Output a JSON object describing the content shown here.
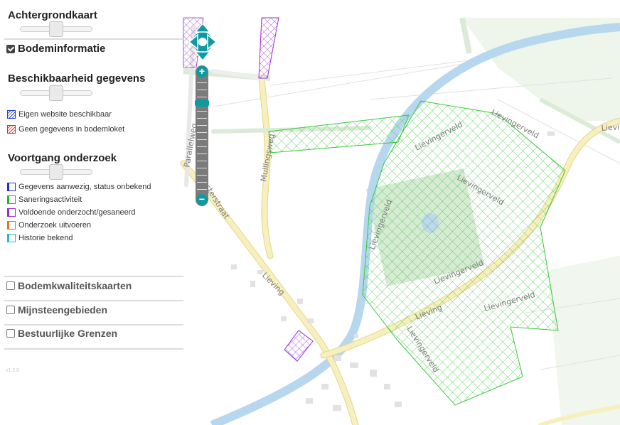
{
  "panel": {
    "achtergrondkaart": {
      "title": "Achtergrondkaart",
      "slider_value": 50
    },
    "bodeminformatie": {
      "label": "Bodeminformatie",
      "checked": true
    },
    "beschikbaarheid": {
      "title": "Beschikbaarheid gegevens",
      "slider_value": 50,
      "legend": [
        {
          "label": "Eigen website beschikbaar",
          "color": "#1c3fd6",
          "pattern": "hatch"
        },
        {
          "label": "Geen gegevens in bodemloket",
          "color": "#d43030",
          "pattern": "hatch"
        }
      ]
    },
    "voortgang": {
      "title": "Voortgang onderzoek",
      "slider_value": 50,
      "legend": [
        {
          "label": "Gegevens aanwezig, status onbekend",
          "color": "#1c2fd6"
        },
        {
          "label": "Saneringsactiviteit",
          "color": "#28b428"
        },
        {
          "label": "Voldoende onderzocht/gesaneerd",
          "color": "#9a2fd0"
        },
        {
          "label": "Onderzoek uitvoeren",
          "color": "#e07a10"
        },
        {
          "label": "Historie bekend",
          "color": "#2ab8c8"
        }
      ]
    },
    "layers": [
      {
        "label": "Bodemkwaliteitskaarten",
        "checked": false
      },
      {
        "label": "Mijnsteengebieden",
        "checked": false
      },
      {
        "label": "Bestuurlijke Grenzen",
        "checked": false
      }
    ],
    "version": "v1.2.0"
  },
  "map": {
    "zoom_in_label": "+",
    "zoom_out_label": "−",
    "street_labels": {
      "lievingerveld_1": "Lievingerveld",
      "lievingerveld_2": "Lievingerveld",
      "lievingerveld_3": "Lievingerveld",
      "lievingerveld_4": "Lievingerveld",
      "lievingerveld_5": "Lievingerveld",
      "lievingerveld_6": "Lievingerveld",
      "lievingerveld_7": "Lievingerveld",
      "lievingerveld_8": "Lievingerveld",
      "lieving_1": "Lieving",
      "lieving_2": "Lieving",
      "lieving_3": "Lievi",
      "mullingsweg": "Mullingsweg",
      "parallelweg": "Parallelweg",
      "oosterstraat": "Oosterstraat"
    },
    "colors": {
      "water": "#b7d7ee",
      "road_major": "#f6ecb4",
      "road_edge": "#e2d48a",
      "grass": "#cfe6cc",
      "hatch_green": "#39c839"
    }
  }
}
